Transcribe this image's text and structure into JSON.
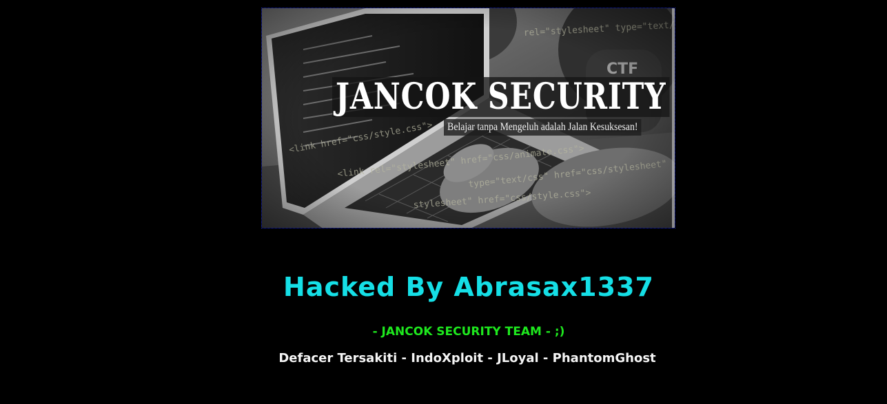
{
  "banner": {
    "title": "JANCOK SECURITY",
    "tagline": "Belajar tanpa Mengeluh adalah Jalan Kesuksesan!",
    "border_color": "#1a2bd6"
  },
  "headline": "Hacked By Abrasax1337",
  "team_line": "- JANCOK SECURITY TEAM - ;)",
  "greets_line": "Defacer Tersakiti - IndoXploit - JLoyal - PhantomGhost",
  "colors": {
    "background": "#000000",
    "headline": "#15dfe6",
    "team": "#1ee81e",
    "greets": "#f5f5f5"
  }
}
